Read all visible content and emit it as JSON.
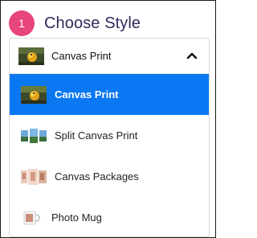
{
  "step": {
    "number": "1",
    "title": "Choose Style"
  },
  "dropdown": {
    "selected_label": "Canvas Print",
    "options": [
      {
        "label": "Canvas Print",
        "icon": "parrot-canvas-thumbnail",
        "active": true
      },
      {
        "label": "Split Canvas Print",
        "icon": "split-canvas-thumbnail",
        "active": false
      },
      {
        "label": "Canvas Packages",
        "icon": "canvas-packages-thumbnail",
        "active": false
      },
      {
        "label": "Photo Mug",
        "icon": "photo-mug-thumbnail",
        "active": false
      }
    ]
  },
  "colors": {
    "badge": "#e8457c",
    "title": "#2f2a5c",
    "active": "#0a78f2"
  }
}
